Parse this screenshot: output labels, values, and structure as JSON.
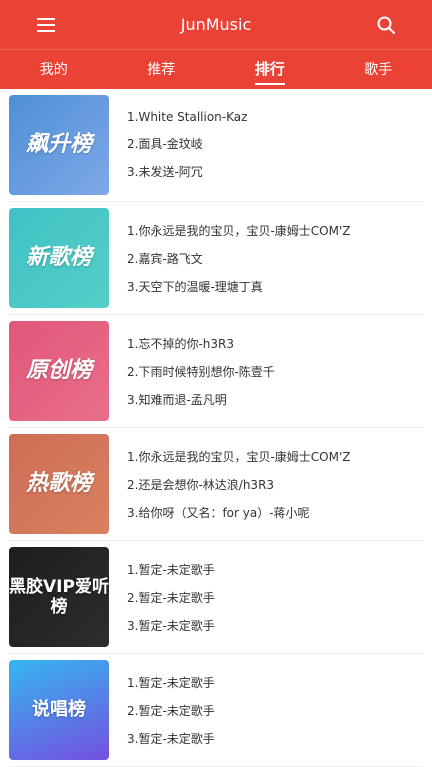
{
  "header": {
    "title": "JunMusic",
    "menu_icon": "hamburger-menu-icon",
    "search_icon": "search-icon"
  },
  "tabs": [
    {
      "label": "我的"
    },
    {
      "label": "推荐"
    },
    {
      "label": "排行"
    },
    {
      "label": "歌手"
    }
  ],
  "active_tab": "排行",
  "colors": {
    "brand": "#ea4335"
  },
  "rankings": [
    {
      "cover_label": "飙升榜",
      "songs": [
        "1.White Stallion-Kaz",
        "2.面具-金玟岐",
        "3.未发送-阿冗"
      ]
    },
    {
      "cover_label": "新歌榜",
      "songs": [
        "1.你永远是我的宝贝，宝贝-康姆士COM'Z",
        "2.嘉宾-路飞文",
        "3.天空下的温暖-理塘丁真"
      ]
    },
    {
      "cover_label": "原创榜",
      "songs": [
        "1.忘不掉的你-h3R3",
        "2.下雨时候特别想你-陈壹千",
        "3.知难而退-孟凡明"
      ]
    },
    {
      "cover_label": "热歌榜",
      "songs": [
        "1.你永远是我的宝贝，宝贝-康姆士COM'Z",
        "2.还是会想你-林达浪/h3R3",
        "3.给你呀（又名：for ya）-蒋小呢"
      ]
    },
    {
      "cover_label": "黑胶VIP爱听榜",
      "songs": [
        "1.暂定-未定歌手",
        "2.暂定-未定歌手",
        "3.暂定-未定歌手"
      ]
    },
    {
      "cover_label": "说唱榜",
      "songs": [
        "1.暂定-未定歌手",
        "2.暂定-未定歌手",
        "3.暂定-未定歌手"
      ]
    }
  ]
}
